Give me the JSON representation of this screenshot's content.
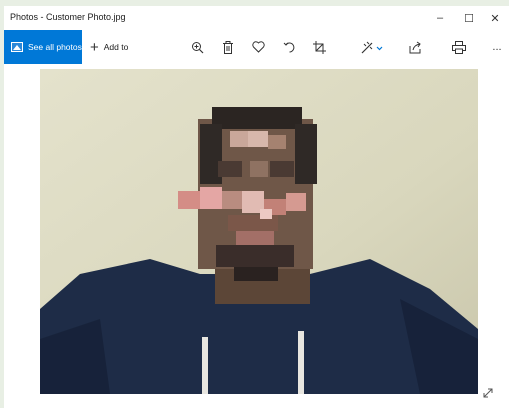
{
  "window": {
    "title": "Photos - Customer Photo.jpg",
    "controls": {
      "minimize": "–",
      "maximize": "☐",
      "close": "✕"
    }
  },
  "toolbar": {
    "see_all_label": "See all photos",
    "add_to_label": "Add to",
    "add_to_symbol": "+",
    "more_label": "...",
    "icons": [
      "zoom-icon",
      "delete-icon",
      "favorite-icon",
      "rotate-icon",
      "crop-icon",
      "edit-create-icon",
      "share-icon",
      "print-icon"
    ]
  },
  "photo": {
    "filename": "Customer Photo.jpg"
  },
  "colors": {
    "accent": "#0078d7",
    "background": "#e8efe4"
  }
}
